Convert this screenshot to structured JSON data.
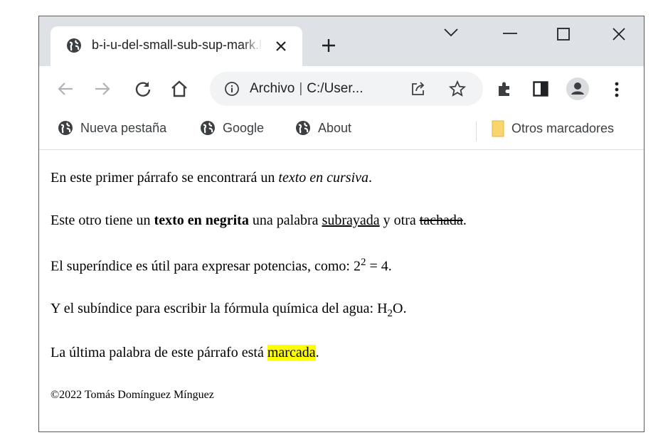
{
  "browser": {
    "tab_title": "b-i-u-del-small-sub-sup-mark.html",
    "address": {
      "security_label": "Archivo",
      "url": "C:/User..."
    },
    "bookmarks": [
      {
        "label": "Nueva pestaña",
        "icon": "globe-icon"
      },
      {
        "label": "Google",
        "icon": "globe-icon"
      },
      {
        "label": "About",
        "icon": "globe-icon"
      }
    ],
    "other_bookmarks": "Otros marcadores",
    "colors": {
      "titlebar": "#dee1e6",
      "omnibox": "#f1f3f4",
      "highlight": "#ffff00"
    }
  },
  "page": {
    "p1": {
      "before": "En este primer párrafo se encontrará un ",
      "italic": "texto en cursiva",
      "after": "."
    },
    "p2": {
      "before": "Este otro tiene un ",
      "bold": "texto en negrita",
      "middle": " una palabra ",
      "underline": "subrayada",
      "middle2": " y otra ",
      "strike": "tachada",
      "after": "."
    },
    "p3": {
      "before": "El superíndice es útil para expresar potencias, como: 2",
      "sup": "2",
      "after": " = 4."
    },
    "p4": {
      "before": "Y el subíndice para escribir la fórmula química del agua: H",
      "sub": "2",
      "after": "O."
    },
    "p5": {
      "before": "La última palabra de este párrafo está ",
      "mark": "marcada",
      "after": "."
    },
    "footer": "©2022 Tomás Domínguez Mínguez"
  }
}
